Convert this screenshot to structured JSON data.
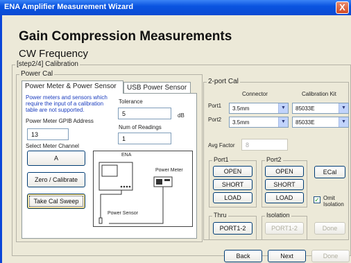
{
  "window": {
    "title": "ENA Amplifier Measurement Wizard",
    "close": "X"
  },
  "header": {
    "title": "Gain Compression Measurements",
    "subtitle": "CW Frequency"
  },
  "step": "[step2/4] Calibration",
  "power_cal": {
    "legend": "Power Cal",
    "tabs": [
      "Power Meter & Power Sensor",
      "USB Power Sensor"
    ],
    "note": "Power meters and sensors which require the input of a calibration table are not supported.",
    "gpib_label": "Power Meter GPIB Address",
    "gpib_value": "13",
    "channel_label": "Select Meter Channel",
    "channel_button": "A",
    "tolerance_label": "Tolerance",
    "tolerance_value": "5",
    "tolerance_unit": "dB",
    "readings_label": "Num of Readings",
    "readings_value": "1",
    "zero_button": "Zero / Calibrate",
    "sweep_button": "Take Cal Sweep",
    "diagram": {
      "ena": "ENA",
      "meter": "Power Meter",
      "sensor": "Power Sensor"
    }
  },
  "two_port": {
    "legend": "2-port Cal",
    "connector_header": "Connector",
    "kit_header": "Calibration Kit",
    "ports": [
      {
        "label": "Port1",
        "connector": "3.5mm",
        "kit": "85033E"
      },
      {
        "label": "Port2",
        "connector": "3.5mm",
        "kit": "85033E"
      }
    ],
    "avg_label": "Avg Factor",
    "avg_value": "8",
    "port1": {
      "legend": "Port1",
      "buttons": [
        "OPEN",
        "SHORT",
        "LOAD"
      ]
    },
    "port2": {
      "legend": "Port2",
      "buttons": [
        "OPEN",
        "SHORT",
        "LOAD"
      ]
    },
    "ecal": "ECal",
    "omit_label": "Omit Isolation",
    "thru": {
      "legend": "Thru",
      "button": "PORT1-2"
    },
    "isolation": {
      "legend": "Isolation",
      "button": "PORT1-2"
    },
    "done": "Done"
  },
  "footer": {
    "back": "Back",
    "next": "Next",
    "done": "Done"
  }
}
